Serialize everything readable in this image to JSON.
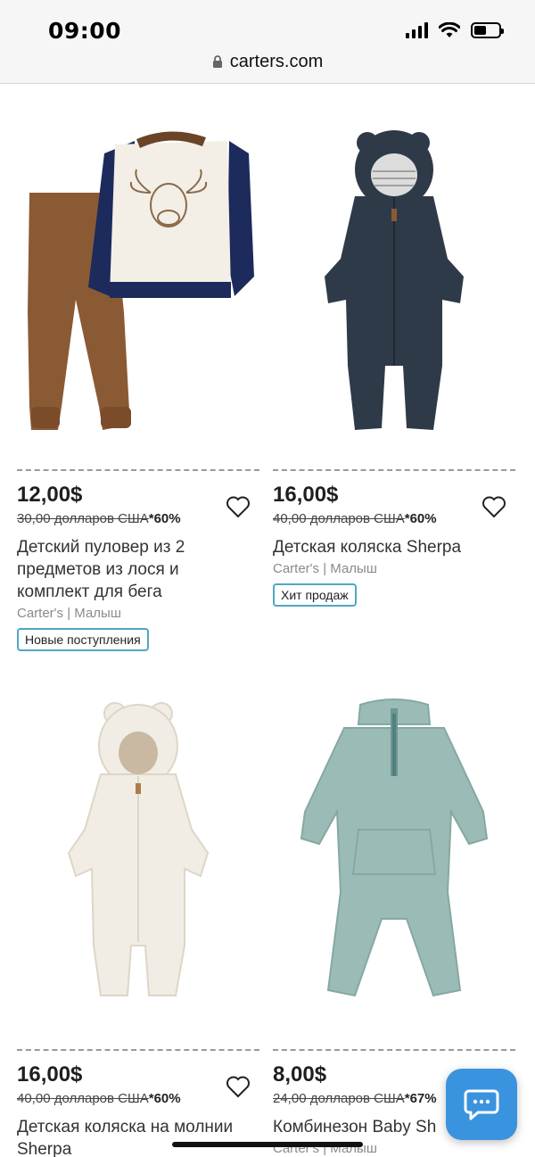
{
  "status_bar": {
    "time": "09:00",
    "battery_level": 0.5
  },
  "browser": {
    "url": "carters.com"
  },
  "products": [
    {
      "price": "12,00$",
      "old_price": "30,00 долларов США",
      "discount": "*60%",
      "title_lines": [
        "Детский пуловер из 2",
        "предметов из лося и",
        "комплект для бега"
      ],
      "brand": "Carter's",
      "category": "Малыш",
      "badge": "Новые поступления"
    },
    {
      "price": "16,00$",
      "old_price": "40,00 долларов США",
      "discount": "*60%",
      "title_lines": [
        "Детская коляска Sherpa"
      ],
      "brand": "Carter's",
      "category": "Малыш",
      "badge": "Хит продаж"
    },
    {
      "price": "16,00$",
      "old_price": "40,00 долларов США",
      "discount": "*60%",
      "title_lines": [
        "Детская коляска на молнии",
        "Sherpa"
      ],
      "brand": "",
      "category": ""
    },
    {
      "price": "8,00$",
      "old_price": "24,00 долларов США",
      "discount": "*67%",
      "title_lines": [
        "Комбинезон Baby Sh"
      ],
      "brand": "Carter's",
      "category": "Малыш"
    }
  ],
  "colors": {
    "badge_border": "#4fa7c4",
    "chat_button": "#3a93df"
  },
  "icons": {
    "heart": "heart-icon",
    "chat": "chat-bubble-icon",
    "lock": "lock-icon"
  }
}
